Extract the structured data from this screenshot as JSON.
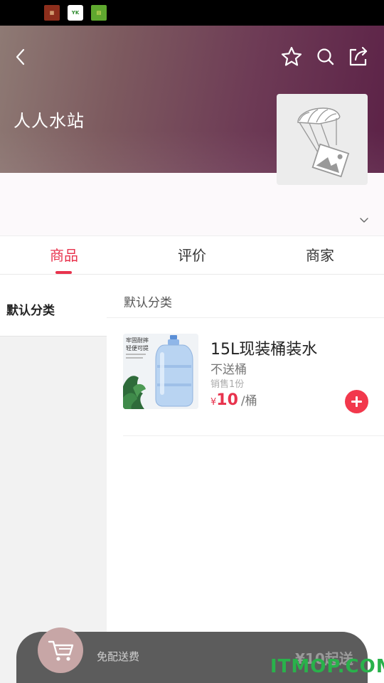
{
  "status_bar": {
    "app_icons": [
      "app-icon-1",
      "app-icon-2",
      "app-icon-3"
    ],
    "app_icon_2_text": "YK"
  },
  "header": {
    "shop_name": "人人水站",
    "icons": [
      "back-icon",
      "star-icon",
      "search-icon",
      "share-icon"
    ],
    "logo_placeholder": "image-placeholder-icon"
  },
  "tabs": [
    {
      "label": "商品",
      "active": true
    },
    {
      "label": "评价",
      "active": false
    },
    {
      "label": "商家",
      "active": false
    }
  ],
  "sidebar": {
    "items": [
      {
        "label": "默认分类",
        "active": true
      }
    ]
  },
  "category": {
    "title": "默认分类"
  },
  "products": [
    {
      "name": "15L现装桶装水",
      "description": "不送桶",
      "sold": "销售1份",
      "currency": "¥",
      "price": "10",
      "unit": "/桶",
      "image_text_1": "牢固耐摔",
      "image_text_2": "轻便可提"
    }
  ],
  "cart_bar": {
    "delivery_text": "免配送费",
    "min_order_text": "¥10起送",
    "icon": "cart-icon"
  },
  "watermark": "ITMOP.COM",
  "colors": {
    "accent": "#e8334d",
    "add_button": "#f2384c",
    "cart_bar": "#5c5c5c",
    "cart_button": "#c7a6a6",
    "watermark": "#29b24b"
  }
}
